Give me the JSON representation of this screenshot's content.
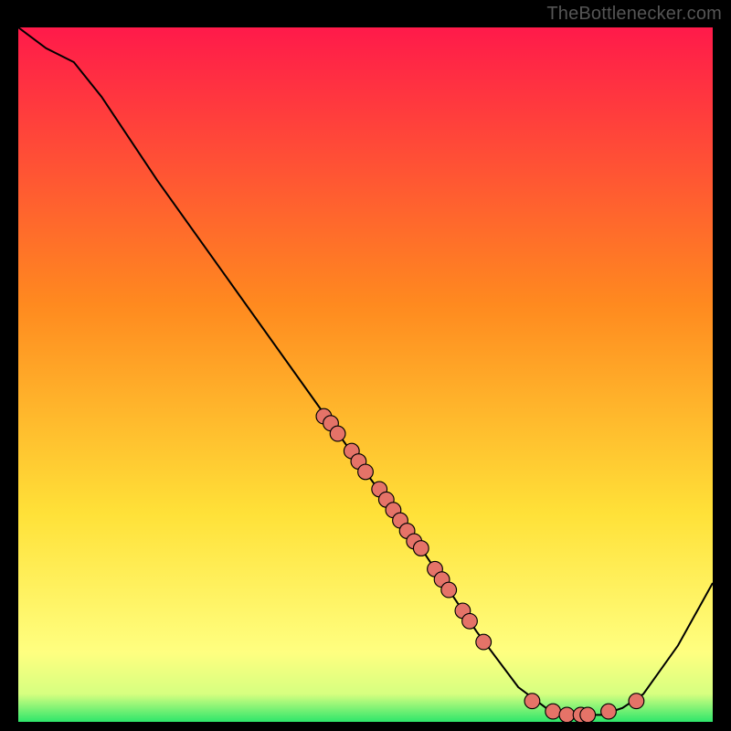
{
  "attribution": "TheBottlenecker.com",
  "colors": {
    "page_bg": "#000000",
    "curve_stroke": "#000000",
    "point_fill": "#e57368",
    "point_stroke": "#000000",
    "gradient_top": "#ff1a4a",
    "gradient_mid": "#ffe138",
    "gradient_bottom": "#2ee66b"
  },
  "chart_data": {
    "type": "line",
    "title": "",
    "xlabel": "",
    "ylabel": "",
    "xlim": [
      0,
      100
    ],
    "ylim": [
      0,
      100
    ],
    "curve": [
      {
        "x": 0,
        "y": 100
      },
      {
        "x": 4,
        "y": 97
      },
      {
        "x": 8,
        "y": 95
      },
      {
        "x": 12,
        "y": 90
      },
      {
        "x": 20,
        "y": 78
      },
      {
        "x": 30,
        "y": 64
      },
      {
        "x": 40,
        "y": 50
      },
      {
        "x": 50,
        "y": 36
      },
      {
        "x": 58,
        "y": 25
      },
      {
        "x": 66,
        "y": 13
      },
      {
        "x": 72,
        "y": 5
      },
      {
        "x": 76,
        "y": 2
      },
      {
        "x": 80,
        "y": 1
      },
      {
        "x": 84,
        "y": 1
      },
      {
        "x": 87,
        "y": 2
      },
      {
        "x": 90,
        "y": 4
      },
      {
        "x": 95,
        "y": 11
      },
      {
        "x": 100,
        "y": 20
      }
    ],
    "highlight_points": [
      {
        "x": 44,
        "y": 44
      },
      {
        "x": 45,
        "y": 43
      },
      {
        "x": 46,
        "y": 41.5
      },
      {
        "x": 48,
        "y": 39
      },
      {
        "x": 49,
        "y": 37.5
      },
      {
        "x": 50,
        "y": 36
      },
      {
        "x": 52,
        "y": 33.5
      },
      {
        "x": 53,
        "y": 32
      },
      {
        "x": 54,
        "y": 30.5
      },
      {
        "x": 55,
        "y": 29
      },
      {
        "x": 56,
        "y": 27.5
      },
      {
        "x": 57,
        "y": 26
      },
      {
        "x": 58,
        "y": 25
      },
      {
        "x": 60,
        "y": 22
      },
      {
        "x": 61,
        "y": 20.5
      },
      {
        "x": 62,
        "y": 19
      },
      {
        "x": 64,
        "y": 16
      },
      {
        "x": 65,
        "y": 14.5
      },
      {
        "x": 67,
        "y": 11.5
      },
      {
        "x": 74,
        "y": 3
      },
      {
        "x": 77,
        "y": 1.5
      },
      {
        "x": 79,
        "y": 1
      },
      {
        "x": 81,
        "y": 1
      },
      {
        "x": 82,
        "y": 1
      },
      {
        "x": 85,
        "y": 1.5
      },
      {
        "x": 89,
        "y": 3
      }
    ]
  }
}
